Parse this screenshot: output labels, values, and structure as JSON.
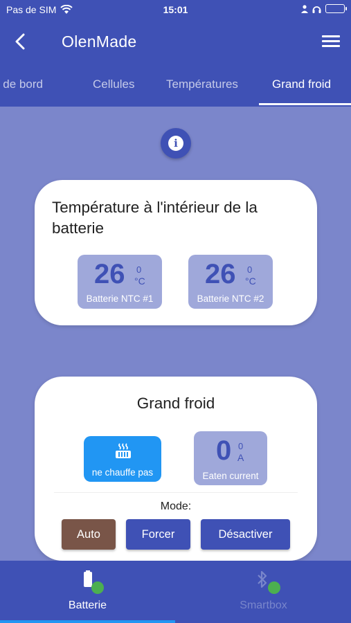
{
  "status_bar": {
    "carrier": "Pas de SIM",
    "time": "15:01"
  },
  "app_bar": {
    "title": "OlenMade"
  },
  "tabs": [
    {
      "label": "Tableau de bord"
    },
    {
      "label": "Cellules"
    },
    {
      "label": "Températures"
    },
    {
      "label": "Grand froid"
    }
  ],
  "battery_temp_card": {
    "title": "Température à l'intérieur de la batterie",
    "sensors": [
      {
        "value": "26",
        "sup": "0",
        "unit": "°C",
        "label": "Batterie NTC #1"
      },
      {
        "value": "26",
        "sup": "0",
        "unit": "°C",
        "label": "Batterie NTC #2"
      }
    ]
  },
  "grand_froid_card": {
    "title": "Grand froid",
    "heater": {
      "label": "ne chauffe pas"
    },
    "current": {
      "value": "0",
      "sup": "0",
      "unit": "A",
      "label": "Eaten current"
    },
    "mode_label": "Mode:",
    "modes": [
      {
        "label": "Auto"
      },
      {
        "label": "Forcer"
      },
      {
        "label": "Désactiver"
      }
    ]
  },
  "bottom_nav": [
    {
      "label": "Batterie"
    },
    {
      "label": "Smartbox"
    }
  ],
  "colors": {
    "primary": "#3f51b5",
    "accent": "#2196f3",
    "auto": "#795548",
    "online": "#4caf50"
  }
}
